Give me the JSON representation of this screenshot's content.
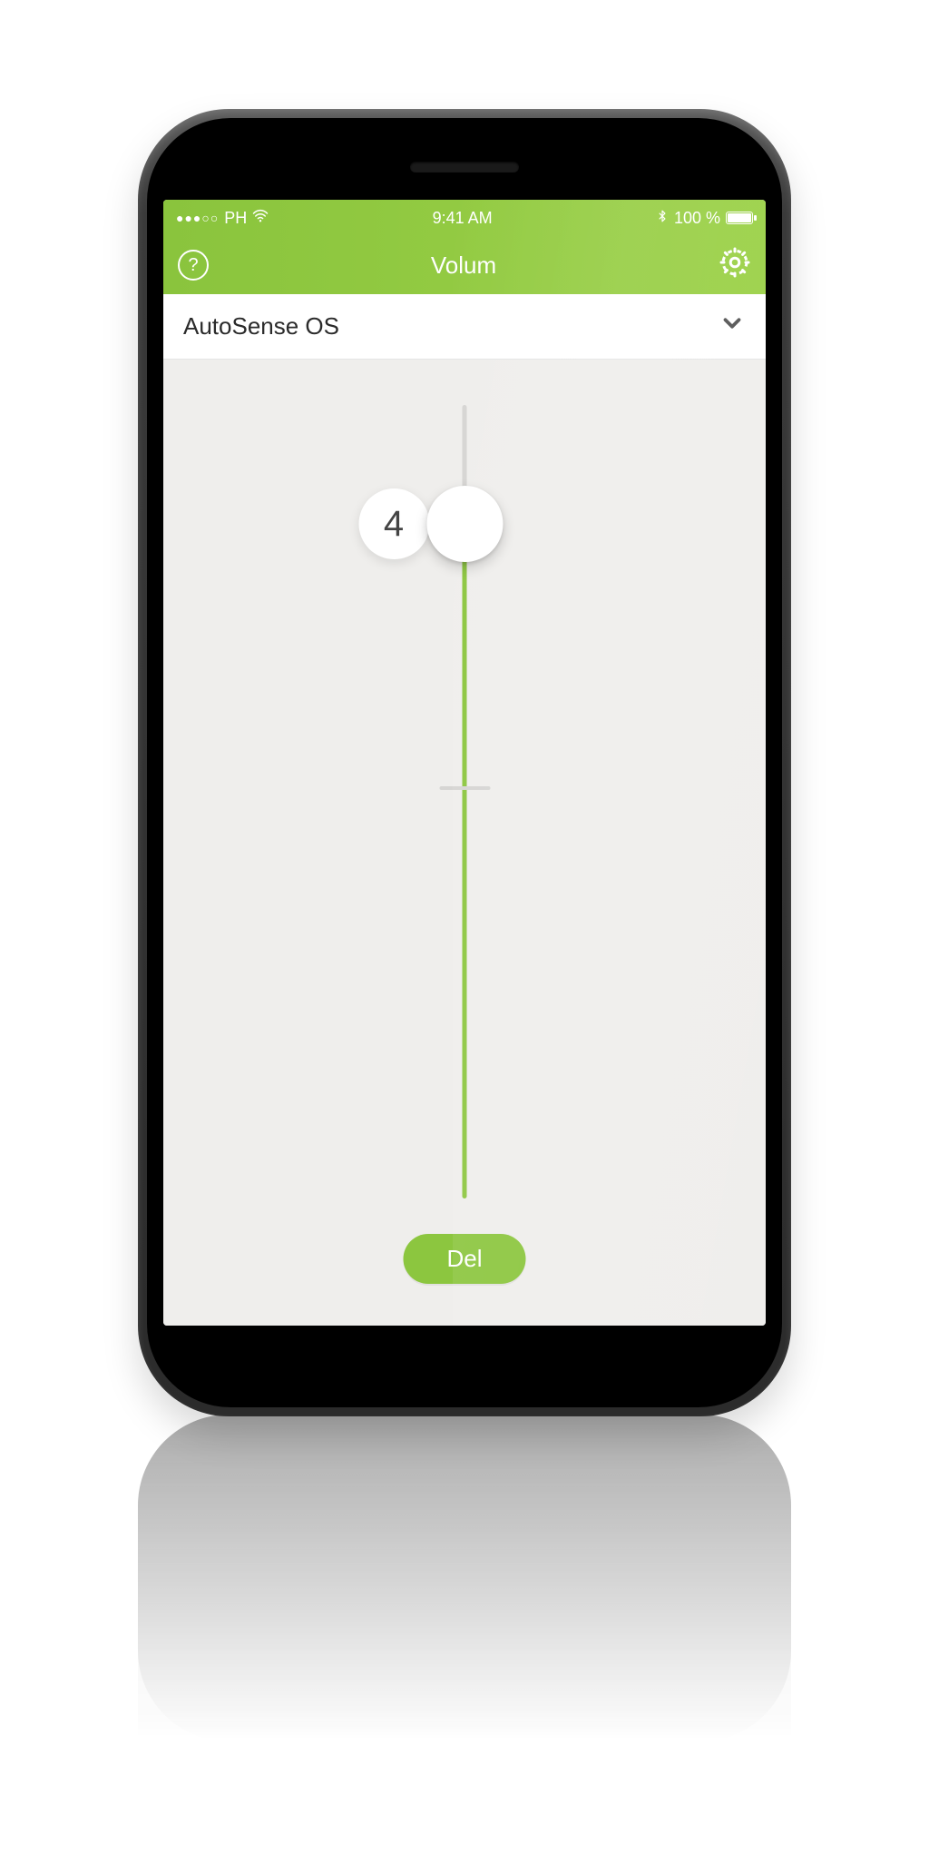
{
  "colors": {
    "accent": "#8cc63f"
  },
  "statusbar": {
    "carrier": "PH",
    "time": "9:41 AM",
    "battery_pct": "100 %"
  },
  "titlebar": {
    "title": "Volum"
  },
  "dropdown": {
    "selected": "AutoSense OS"
  },
  "slider": {
    "value_label": "4",
    "value_fraction_from_top": 0.15,
    "tick_fraction_from_top": 0.48
  },
  "footer": {
    "button_label": "Del"
  }
}
